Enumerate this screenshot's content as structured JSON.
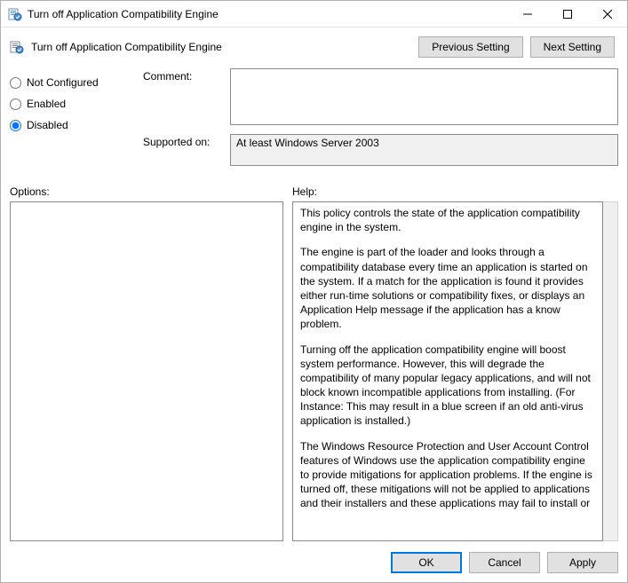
{
  "titlebar": {
    "title": "Turn off Application Compatibility Engine"
  },
  "header": {
    "policy_title": "Turn off Application Compatibility Engine",
    "prev_btn": "Previous Setting",
    "next_btn": "Next Setting"
  },
  "state": {
    "not_configured_label": "Not Configured",
    "enabled_label": "Enabled",
    "disabled_label": "Disabled",
    "selected": "disabled"
  },
  "form": {
    "comment_label": "Comment:",
    "comment_value": "",
    "supported_label": "Supported on:",
    "supported_value": "At least Windows Server 2003"
  },
  "panels": {
    "options_label": "Options:",
    "help_label": "Help:"
  },
  "help": {
    "p1": " This policy controls the state of the application compatibility engine in the system.",
    "p2": "The engine is part of the loader and looks through a compatibility database every time an application is started on the system.  If a match for the application is found it provides either run-time solutions or compatibility fixes, or displays an Application Help message if the application has a know problem.",
    "p3": "Turning off the application compatibility engine will boost system performance.  However, this will degrade the compatibility of many popular legacy applications, and will not block known incompatible applications from installing.  (For Instance: This may result in a blue screen if an old anti-virus application is installed.)",
    "p4": "The Windows Resource Protection and User Account Control features of Windows use the application compatibility engine to provide mitigations for application problems. If the engine is turned off, these mitigations will not be applied to applications and their installers and these applications may fail to install or"
  },
  "footer": {
    "ok": "OK",
    "cancel": "Cancel",
    "apply": "Apply"
  }
}
